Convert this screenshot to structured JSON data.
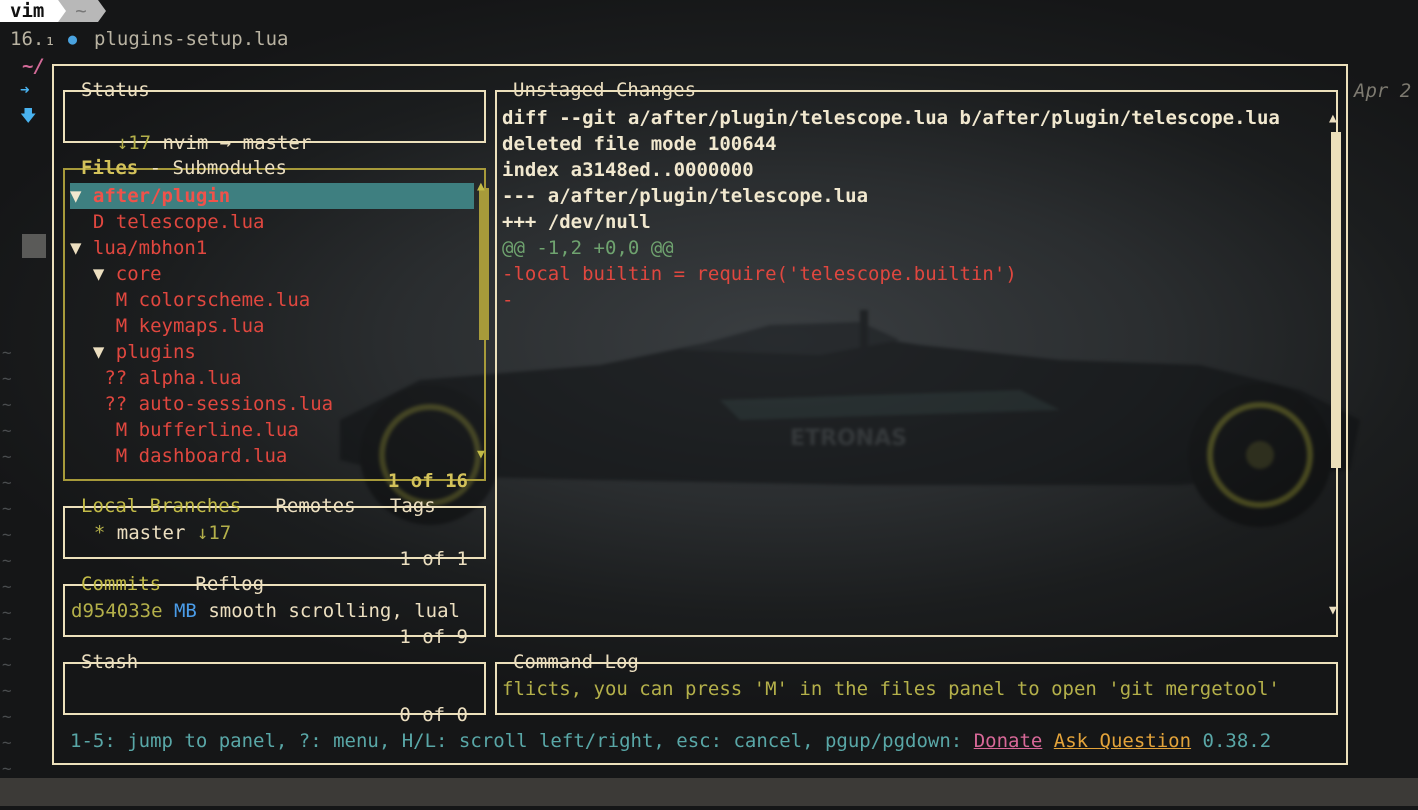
{
  "topbar": {
    "app": "vim",
    "home": "~"
  },
  "editor": {
    "line_number": "16.₁",
    "file_icon": "lua-icon",
    "file_name": "plugins-setup.lua",
    "cwd": "~/",
    "date_hint": "Apr 2",
    "tilde": "~"
  },
  "status_panel": {
    "title": "Status",
    "ahead_behind": "↓17",
    "repo": "nvim",
    "arrow": "→",
    "branch": "master"
  },
  "files_panel": {
    "title_active": "Files",
    "sep": " - ",
    "title_other": "Submodules",
    "count": "1 of 16",
    "rows": [
      {
        "prefix": "▼ ",
        "name": "after/plugin",
        "kind": "dir-selected"
      },
      {
        "prefix": "  D ",
        "name": "telescope.lua",
        "kind": "deleted"
      },
      {
        "prefix": "▼ ",
        "name": "lua/mbhon1",
        "kind": "dir"
      },
      {
        "prefix": "  ▼ ",
        "name": "core",
        "kind": "dir"
      },
      {
        "prefix": "    M ",
        "name": "colorscheme.lua",
        "kind": "modified"
      },
      {
        "prefix": "    M ",
        "name": "keymaps.lua",
        "kind": "modified"
      },
      {
        "prefix": "  ▼ ",
        "name": "plugins",
        "kind": "dir"
      },
      {
        "prefix": "   ?? ",
        "name": "alpha.lua",
        "kind": "untracked"
      },
      {
        "prefix": "   ?? ",
        "name": "auto-sessions.lua",
        "kind": "untracked"
      },
      {
        "prefix": "    M ",
        "name": "bufferline.lua",
        "kind": "modified"
      },
      {
        "prefix": "    M ",
        "name": "dashboard.lua",
        "kind": "modified"
      }
    ]
  },
  "branches_panel": {
    "title_active": "Local Branches",
    "sep1": " - ",
    "title_remotes": "Remotes",
    "sep2": " - ",
    "title_tags": "Tags",
    "star": "*",
    "branch": "master",
    "behind": "↓17",
    "count": "1 of 1"
  },
  "commits_panel": {
    "title_active": "Commits",
    "sep": " - ",
    "title_other": "Reflog",
    "hash": "d954033e",
    "author": "MB",
    "message": "smooth scrolling, lual",
    "count": "1 of 9"
  },
  "stash_panel": {
    "title": "Stash",
    "count": "0 of 0"
  },
  "diff_panel": {
    "title": "Unstaged Changes",
    "lines": [
      {
        "text": "diff --git a/after/plugin/telescope.lua b/after/plugin/telescope.lua",
        "kind": "header"
      },
      {
        "text": "deleted file mode 100644",
        "kind": "header"
      },
      {
        "text": "index a3148ed..0000000",
        "kind": "header"
      },
      {
        "text": "--- a/after/plugin/telescope.lua",
        "kind": "header"
      },
      {
        "text": "+++ /dev/null",
        "kind": "header"
      },
      {
        "text": "@@ -1,2 +0,0 @@",
        "kind": "hunk"
      },
      {
        "text": "-local builtin = require('telescope.builtin')",
        "kind": "removed"
      },
      {
        "text": "-",
        "kind": "removed"
      }
    ]
  },
  "command_log": {
    "title": "Command Log",
    "text": "flicts, you can press 'M' in the files panel to open 'git mergetool'"
  },
  "footer": {
    "hints": "1-5: jump to panel, ?: menu, H/L: scroll left/right, esc: cancel, pgup/pgdown:",
    "donate": "Donate",
    "ask": "Ask Question",
    "version": "0.38.2"
  },
  "colors": {
    "active_border": "#a79a3a",
    "border": "#ece0bb",
    "selection": "#3e7f80",
    "removed": "#e0473f",
    "hunk": "#6fa36f"
  }
}
